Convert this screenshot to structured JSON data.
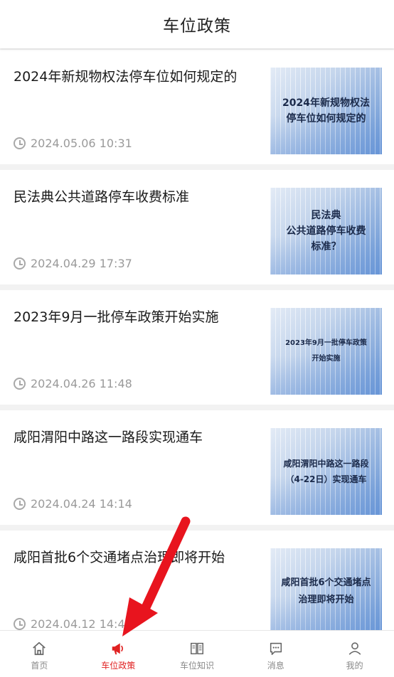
{
  "header": {
    "title": "车位政策"
  },
  "articles": [
    {
      "title": "2024年新规物权法停车位如何规定的",
      "time": "2024.05.06 10:31",
      "thumb": "2024年新规物权法\n停车位如何规定的"
    },
    {
      "title": "民法典公共道路停车收费标准",
      "time": "2024.04.29 17:37",
      "thumb": "民法典\n公共道路停车收费\n标准？"
    },
    {
      "title": "2023年9月一批停车政策开始实施",
      "time": "2024.04.26 11:48",
      "thumb": "2023年9月一批停车政策\n开始实施"
    },
    {
      "title": "咸阳渭阳中路这一路段实现通车",
      "time": "2024.04.24 14:14",
      "thumb": "咸阳渭阳中路这一路段\n（4-22日）实现通车"
    },
    {
      "title": "咸阳首批6个交通堵点治理即将开始",
      "time": "2024.04.12 14:42",
      "thumb": "咸阳首批6个交通堵点\n治理即将开始"
    }
  ],
  "nav": [
    {
      "label": "首页",
      "icon": "home-icon"
    },
    {
      "label": "车位政策",
      "icon": "megaphone-icon",
      "active": true
    },
    {
      "label": "车位知识",
      "icon": "book-icon"
    },
    {
      "label": "消息",
      "icon": "message-icon"
    },
    {
      "label": "我的",
      "icon": "user-icon"
    }
  ],
  "colors": {
    "accent": "#e02020",
    "arrow": "#e8141e"
  }
}
